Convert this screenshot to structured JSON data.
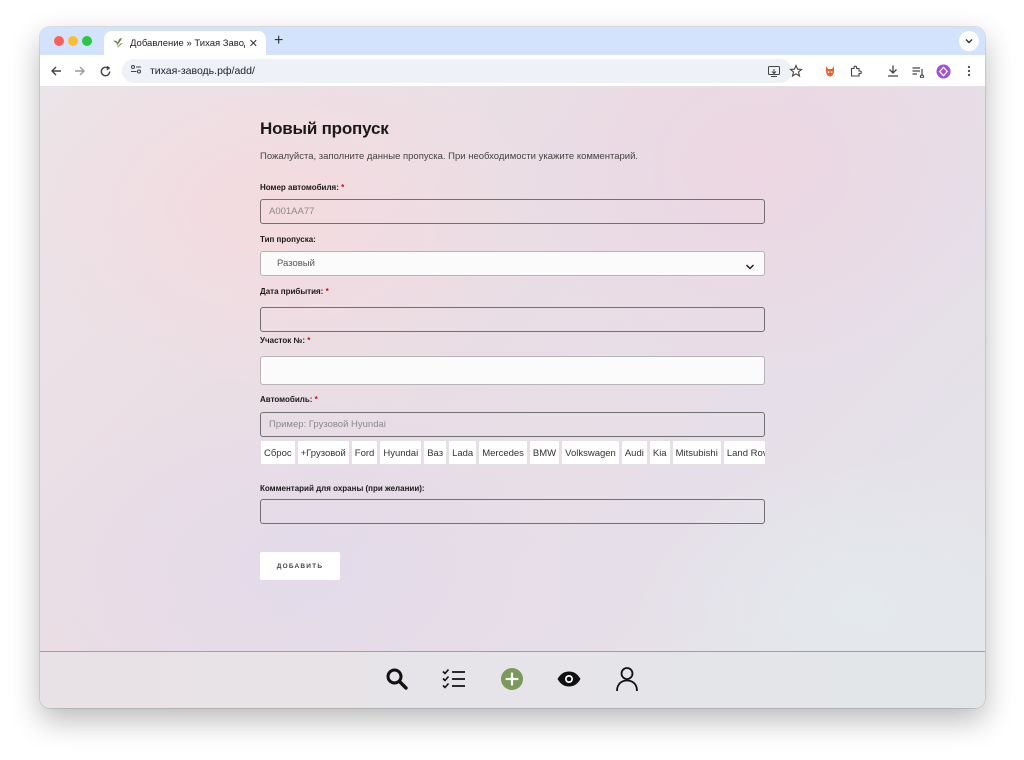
{
  "browser": {
    "tab_title": "Добавление » Тихая Заводь",
    "url": "тихая-заводь.рф/add/"
  },
  "page": {
    "title": "Новый пропуск",
    "subtitle": "Пожалуйста, заполните данные пропуска. При необходимости укажите комментарий."
  },
  "form": {
    "car_number": {
      "label": "Номер автомобиля:",
      "required": "*",
      "placeholder": "A001AA77"
    },
    "pass_type": {
      "label": "Тип пропуска:",
      "value": "Разовый"
    },
    "arrival_date": {
      "label": "Дата прибытия:",
      "required": "*"
    },
    "plot": {
      "label": "Участок №:",
      "required": "*"
    },
    "car": {
      "label": "Автомобиль:",
      "required": "*",
      "placeholder": "Пример: Грузовой Hyundai"
    },
    "car_chips": [
      "Сброс",
      "+Грузовой",
      "Ford",
      "Hyundai",
      "Ваз",
      "Lada",
      "Mercedes",
      "BMW",
      "Volkswagen",
      "Audi",
      "Kia",
      "Mitsubishi",
      "Land Rover"
    ],
    "comment": {
      "label": "Комментарий для охраны (при желании):"
    },
    "submit_label": "ДОБАВИТЬ"
  },
  "icons": {
    "nav": [
      "search-icon",
      "checklist-icon",
      "add-circle-icon",
      "eye-icon",
      "user-icon"
    ],
    "accent_color": "#7a9a5c"
  }
}
